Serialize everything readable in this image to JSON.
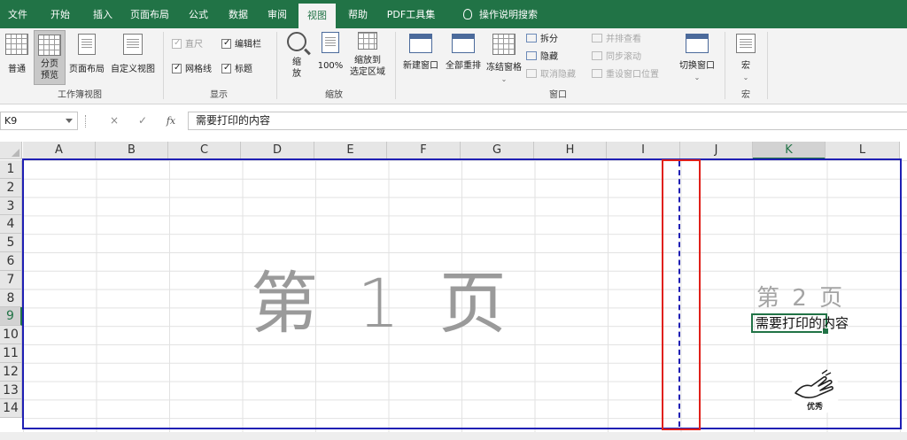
{
  "ribbon_tabs": [
    "文件",
    "开始",
    "插入",
    "页面布局",
    "公式",
    "数据",
    "审阅",
    "视图",
    "帮助",
    "PDF工具集",
    "操作说明搜索"
  ],
  "active_tab": "视图",
  "groups": {
    "workbook_views": {
      "label": "工作簿视图",
      "normal": "普通",
      "page_break_preview_1": "分页",
      "page_break_preview_2": "预览",
      "page_layout": "页面布局",
      "custom_views": "自定义视图"
    },
    "show": {
      "label": "显示",
      "ruler": "直尺",
      "formula_bar": "编辑栏",
      "gridlines": "网格线",
      "headings": "标题"
    },
    "zoom": {
      "label": "缩放",
      "zoom_1": "缩",
      "zoom_2": "放",
      "zoom100": "100%",
      "zoom_selection_1": "缩放到",
      "zoom_selection_2": "选定区域"
    },
    "window": {
      "label": "窗口",
      "new_window": "新建窗口",
      "arrange_all": "全部重排",
      "freeze_panes": "冻结窗格",
      "split": "拆分",
      "hide": "隐藏",
      "unhide": "取消隐藏",
      "side_by_side": "并排查看",
      "sync_scroll": "同步滚动",
      "reset_position": "重设窗口位置",
      "switch_windows": "切换窗口"
    },
    "macros": {
      "label": "宏",
      "macros": "宏"
    }
  },
  "formula_bar": {
    "cell_ref": "K9",
    "cancel": "×",
    "enter": "✓",
    "fx": "fx",
    "content": "需要打印的内容"
  },
  "columns": [
    "A",
    "B",
    "C",
    "D",
    "E",
    "F",
    "G",
    "H",
    "I",
    "J",
    "K",
    "L"
  ],
  "rows": [
    "1",
    "2",
    "3",
    "4",
    "5",
    "6",
    "7",
    "8",
    "9",
    "10",
    "11",
    "12",
    "13",
    "14"
  ],
  "active_column": "K",
  "active_row": "9",
  "page1_watermark": "第 1 页",
  "page2_watermark": "第 2 页",
  "cell_k9_value": "需要打印的内容",
  "badge_text": "优秀",
  "colors": {
    "excel_green": "#217346",
    "page_border": "#1f1fb4",
    "highlight_red": "#e0201a"
  }
}
